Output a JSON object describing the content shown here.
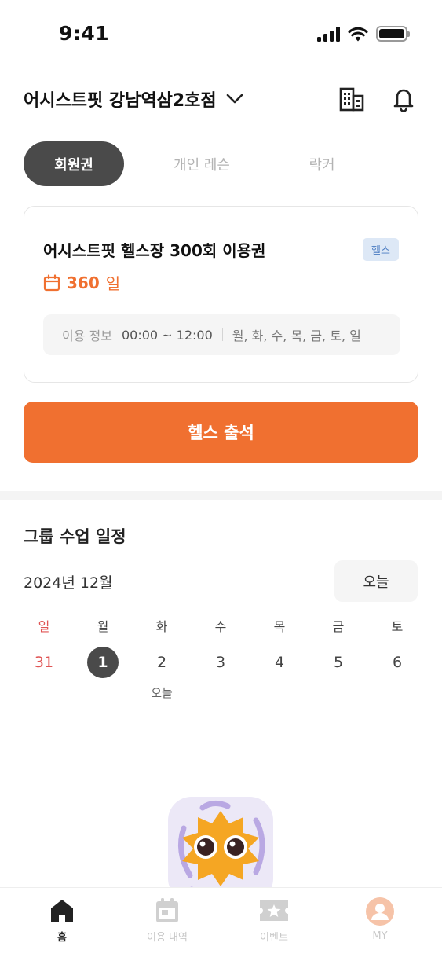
{
  "status_bar": {
    "time": "9:41"
  },
  "header": {
    "gym_name": "어시스트핏 강남역삼2호점"
  },
  "tabs": [
    {
      "label": "회원권",
      "active": true
    },
    {
      "label": "개인 레슨",
      "active": false
    },
    {
      "label": "락커",
      "active": false
    }
  ],
  "membership": {
    "title": "어시스트핏 헬스장 300회 이용권",
    "tag": "헬스",
    "days_value": "360",
    "days_unit": "일",
    "info_label": "이용 정보",
    "info_time": "00:00 ~ 12:00",
    "info_days": "월, 화, 수, 목, 금, 토, 일"
  },
  "checkin": {
    "label": "헬스 출석"
  },
  "schedule": {
    "title": "그룹 수업 일정",
    "month": "2024년 12월",
    "today_button": "오늘",
    "weekdays": [
      "일",
      "월",
      "화",
      "수",
      "목",
      "금",
      "토"
    ],
    "dates": [
      "31",
      "1",
      "2",
      "3",
      "4",
      "5",
      "6"
    ],
    "selected_index": 1,
    "today_index": 2,
    "today_mark": "오늘"
  },
  "bottom_nav": [
    {
      "label": "홈",
      "icon": "home-icon",
      "active": true
    },
    {
      "label": "이용 내역",
      "icon": "calendar-icon",
      "active": false
    },
    {
      "label": "이벤트",
      "icon": "ticket-star-icon",
      "active": false
    },
    {
      "label": "MY",
      "icon": "profile-icon",
      "active": false
    }
  ],
  "colors": {
    "accent": "#f07030",
    "dark_pill": "#4a4a4a",
    "sunday": "#e05555",
    "tag_bg": "#dde8f6",
    "tag_text": "#4a7bc1"
  }
}
